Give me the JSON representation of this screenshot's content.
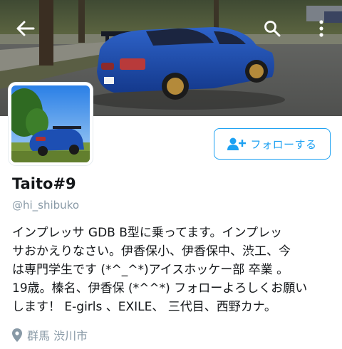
{
  "header": {
    "back_icon": "arrow-left-icon",
    "search_icon": "search-icon",
    "more_icon": "more-vertical-icon",
    "overlay_icon_color": "#ffffff"
  },
  "profile": {
    "display_name": "Taito#9",
    "handle": "@hi_shibuko",
    "bio": "インプレッサ GDB B型に乗ってます。インプレッ\nサおかえりなさい。伊香保小、伊香保中、渋工、今\nは専門学生です (*^_^*)アイスホッケー部 卒業 。\n19歳。榛名、伊香保 (*^^*) フォローよろしくお願い\nします！ E-girls 、EXILE、 三代目、西野カナ。",
    "location": "群馬 渋川市",
    "location_icon": "location-pin-icon"
  },
  "follow_button": {
    "label": "フォローする",
    "icon": "add-user-icon",
    "accent": "#1da1f2"
  },
  "colors": {
    "secondary_text": "#8899a6",
    "primary_text": "#14171a"
  }
}
